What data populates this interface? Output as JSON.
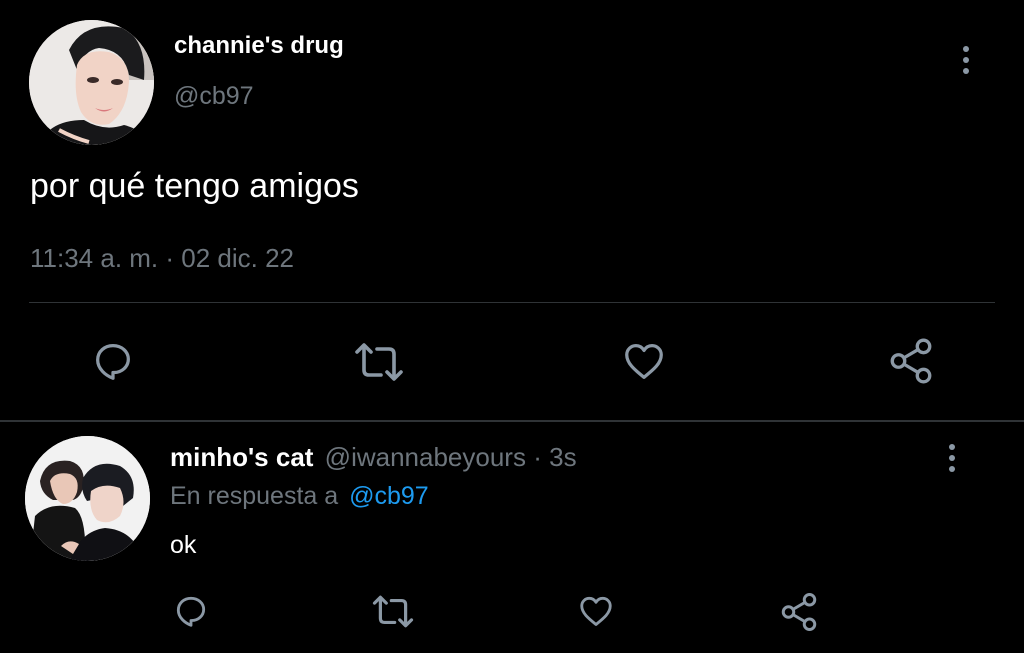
{
  "main_tweet": {
    "display_name": "channie's drug",
    "handle": "@cb97",
    "text": "por qué tengo amigos",
    "timestamp": "11:34 a. m. · 02 dic. 22"
  },
  "reply": {
    "display_name": "minho's cat",
    "handle": "@iwannabeyours",
    "separator": "·",
    "time_ago": "3s",
    "replying_prefix": "En respuesta a",
    "replying_to": "@cb97",
    "text": "ok"
  },
  "icons": {
    "reply": "reply-icon",
    "retweet": "retweet-icon",
    "like": "heart-icon",
    "share": "share-icon",
    "more": "more-vertical-icon"
  },
  "colors": {
    "background": "#000000",
    "text": "#ffffff",
    "muted": "#6e767d",
    "icon": "#8b98a5",
    "link": "#1d9bf0",
    "divider": "#2f3336"
  }
}
